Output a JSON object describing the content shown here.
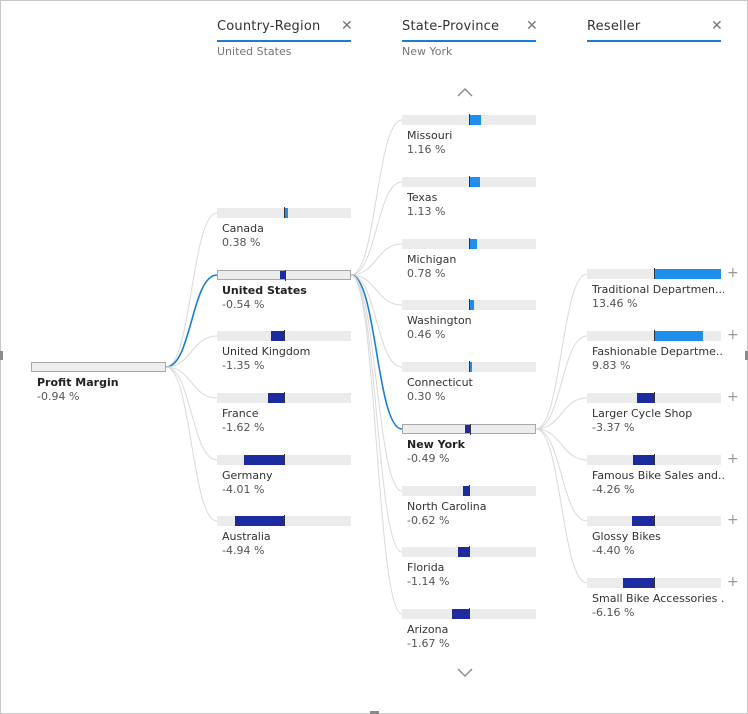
{
  "colors": {
    "negative": "#1c2b9e",
    "positive": "#1e8fed",
    "accent": "#1a7fd4"
  },
  "root": {
    "label": "Profit Margin",
    "value": "-0.94 %",
    "num": -0.94
  },
  "columns": [
    {
      "title": "Country-Region",
      "subtitle": "United States",
      "close_icon": "close-icon"
    },
    {
      "title": "State-Province",
      "subtitle": "New York",
      "close_icon": "close-icon"
    },
    {
      "title": "Reseller",
      "subtitle": "",
      "close_icon": "close-icon"
    }
  ],
  "countries": [
    {
      "label": "Canada",
      "value": "0.38 %",
      "num": 0.38,
      "selected": false
    },
    {
      "label": "United States",
      "value": "-0.54 %",
      "num": -0.54,
      "selected": true
    },
    {
      "label": "United Kingdom",
      "value": "-1.35 %",
      "num": -1.35,
      "selected": false
    },
    {
      "label": "France",
      "value": "-1.62 %",
      "num": -1.62,
      "selected": false
    },
    {
      "label": "Germany",
      "value": "-4.01 %",
      "num": -4.01,
      "selected": false
    },
    {
      "label": "Australia",
      "value": "-4.94 %",
      "num": -4.94,
      "selected": false
    }
  ],
  "states": [
    {
      "label": "Missouri",
      "value": "1.16 %",
      "num": 1.16,
      "selected": false
    },
    {
      "label": "Texas",
      "value": "1.13 %",
      "num": 1.13,
      "selected": false
    },
    {
      "label": "Michigan",
      "value": "0.78 %",
      "num": 0.78,
      "selected": false
    },
    {
      "label": "Washington",
      "value": "0.46 %",
      "num": 0.46,
      "selected": false
    },
    {
      "label": "Connecticut",
      "value": "0.30 %",
      "num": 0.3,
      "selected": false
    },
    {
      "label": "New York",
      "value": "-0.49 %",
      "num": -0.49,
      "selected": true
    },
    {
      "label": "North Carolina",
      "value": "-0.62 %",
      "num": -0.62,
      "selected": false
    },
    {
      "label": "Florida",
      "value": "-1.14 %",
      "num": -1.14,
      "selected": false
    },
    {
      "label": "Arizona",
      "value": "-1.67 %",
      "num": -1.67,
      "selected": false
    }
  ],
  "resellers": [
    {
      "label": "Traditional Departmen...",
      "value": "13.46 %",
      "num": 13.46
    },
    {
      "label": "Fashionable Departme...",
      "value": "9.83 %",
      "num": 9.83
    },
    {
      "label": "Larger Cycle Shop",
      "value": "-3.37 %",
      "num": -3.37
    },
    {
      "label": "Famous Bike Sales and...",
      "value": "-4.26 %",
      "num": -4.26
    },
    {
      "label": "Glossy Bikes",
      "value": "-4.40 %",
      "num": -4.4
    },
    {
      "label": "Small Bike Accessories ...",
      "value": "-6.16 %",
      "num": -6.16
    }
  ],
  "icons": {
    "close": "close-icon",
    "expand": "plus-icon",
    "scroll_up": "chevron-up-icon",
    "scroll_down": "chevron-down-icon"
  },
  "symbols": {
    "close": "✕",
    "plus": "+"
  }
}
